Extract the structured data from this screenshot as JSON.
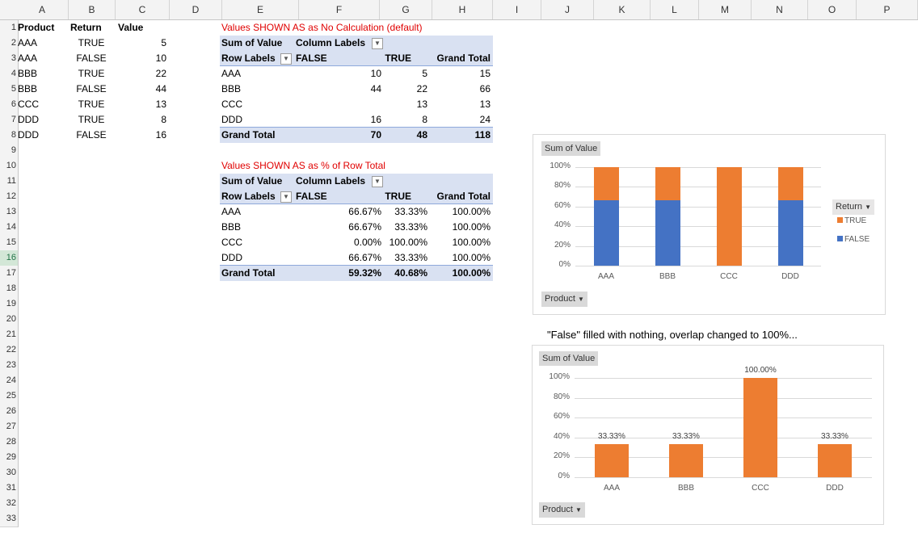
{
  "columns": [
    "A",
    "B",
    "C",
    "D",
    "E",
    "F",
    "G",
    "H",
    "I",
    "J",
    "K",
    "L",
    "M",
    "N",
    "O",
    "P"
  ],
  "rows": [
    "1",
    "2",
    "3",
    "4",
    "5",
    "6",
    "7",
    "8",
    "9",
    "10",
    "11",
    "12",
    "13",
    "14",
    "15",
    "16",
    "17",
    "18",
    "19",
    "20",
    "21",
    "22",
    "23",
    "24",
    "25",
    "26",
    "27",
    "28",
    "29",
    "30",
    "31",
    "32",
    "33"
  ],
  "source": {
    "headers": [
      "Product",
      "Return",
      "Value"
    ],
    "rows": [
      [
        "AAA",
        "TRUE",
        "5"
      ],
      [
        "AAA",
        "FALSE",
        "10"
      ],
      [
        "BBB",
        "TRUE",
        "22"
      ],
      [
        "BBB",
        "FALSE",
        "44"
      ],
      [
        "CCC",
        "TRUE",
        "13"
      ],
      [
        "DDD",
        "TRUE",
        "8"
      ],
      [
        "DDD",
        "FALSE",
        "16"
      ]
    ]
  },
  "pivot1": {
    "title": "Values SHOWN AS as No Calculation (default)",
    "corner": "Sum of Value",
    "col_labels": "Column Labels",
    "row_labels": "Row Labels",
    "col_false": "FALSE",
    "col_true": "TRUE",
    "col_total": "Grand Total",
    "rows": [
      [
        "AAA",
        "10",
        "5",
        "15"
      ],
      [
        "BBB",
        "44",
        "22",
        "66"
      ],
      [
        "CCC",
        "",
        "13",
        "13"
      ],
      [
        "DDD",
        "16",
        "8",
        "24"
      ]
    ],
    "total": [
      "Grand Total",
      "70",
      "48",
      "118"
    ]
  },
  "pivot2": {
    "title": "Values SHOWN AS as % of Row Total",
    "corner": "Sum of Value",
    "col_labels": "Column Labels",
    "row_labels": "Row Labels",
    "col_false": "FALSE",
    "col_true": "TRUE",
    "col_total": "Grand Total",
    "rows": [
      [
        "AAA",
        "66.67%",
        "33.33%",
        "100.00%"
      ],
      [
        "BBB",
        "66.67%",
        "33.33%",
        "100.00%"
      ],
      [
        "CCC",
        "0.00%",
        "100.00%",
        "100.00%"
      ],
      [
        "DDD",
        "66.67%",
        "33.33%",
        "100.00%"
      ]
    ],
    "total": [
      "Grand Total",
      "59.32%",
      "40.68%",
      "100.00%"
    ]
  },
  "chart1": {
    "field_button": "Sum of Value",
    "product_button": "Product",
    "legend_title": "Return",
    "legend": [
      "TRUE",
      "FALSE"
    ]
  },
  "chart2": {
    "caption": "\"False\" filled with nothing, overlap changed to 100%...",
    "field_button": "Sum of Value",
    "product_button": "Product"
  },
  "colors": {
    "true": "#ed7d31",
    "false": "#4472c4"
  },
  "chart_data": [
    {
      "type": "bar",
      "stacked": true,
      "categories": [
        "AAA",
        "BBB",
        "CCC",
        "DDD"
      ],
      "series": [
        {
          "name": "FALSE",
          "values": [
            66.67,
            66.67,
            0,
            66.67
          ]
        },
        {
          "name": "TRUE",
          "values": [
            33.33,
            33.33,
            100,
            33.33
          ]
        }
      ],
      "ylim": [
        0,
        100
      ],
      "yticks": [
        "0%",
        "20%",
        "40%",
        "60%",
        "80%",
        "100%"
      ],
      "grid": true,
      "legend": "right"
    },
    {
      "type": "bar",
      "categories": [
        "AAA",
        "BBB",
        "CCC",
        "DDD"
      ],
      "series": [
        {
          "values": [
            33.33,
            33.33,
            100,
            33.33
          ],
          "labels": [
            "33.33%",
            "33.33%",
            "100.00%",
            "33.33%"
          ]
        }
      ],
      "ylim": [
        0,
        100
      ],
      "yticks": [
        "0%",
        "20%",
        "40%",
        "60%",
        "80%",
        "100%"
      ],
      "grid": true
    }
  ]
}
